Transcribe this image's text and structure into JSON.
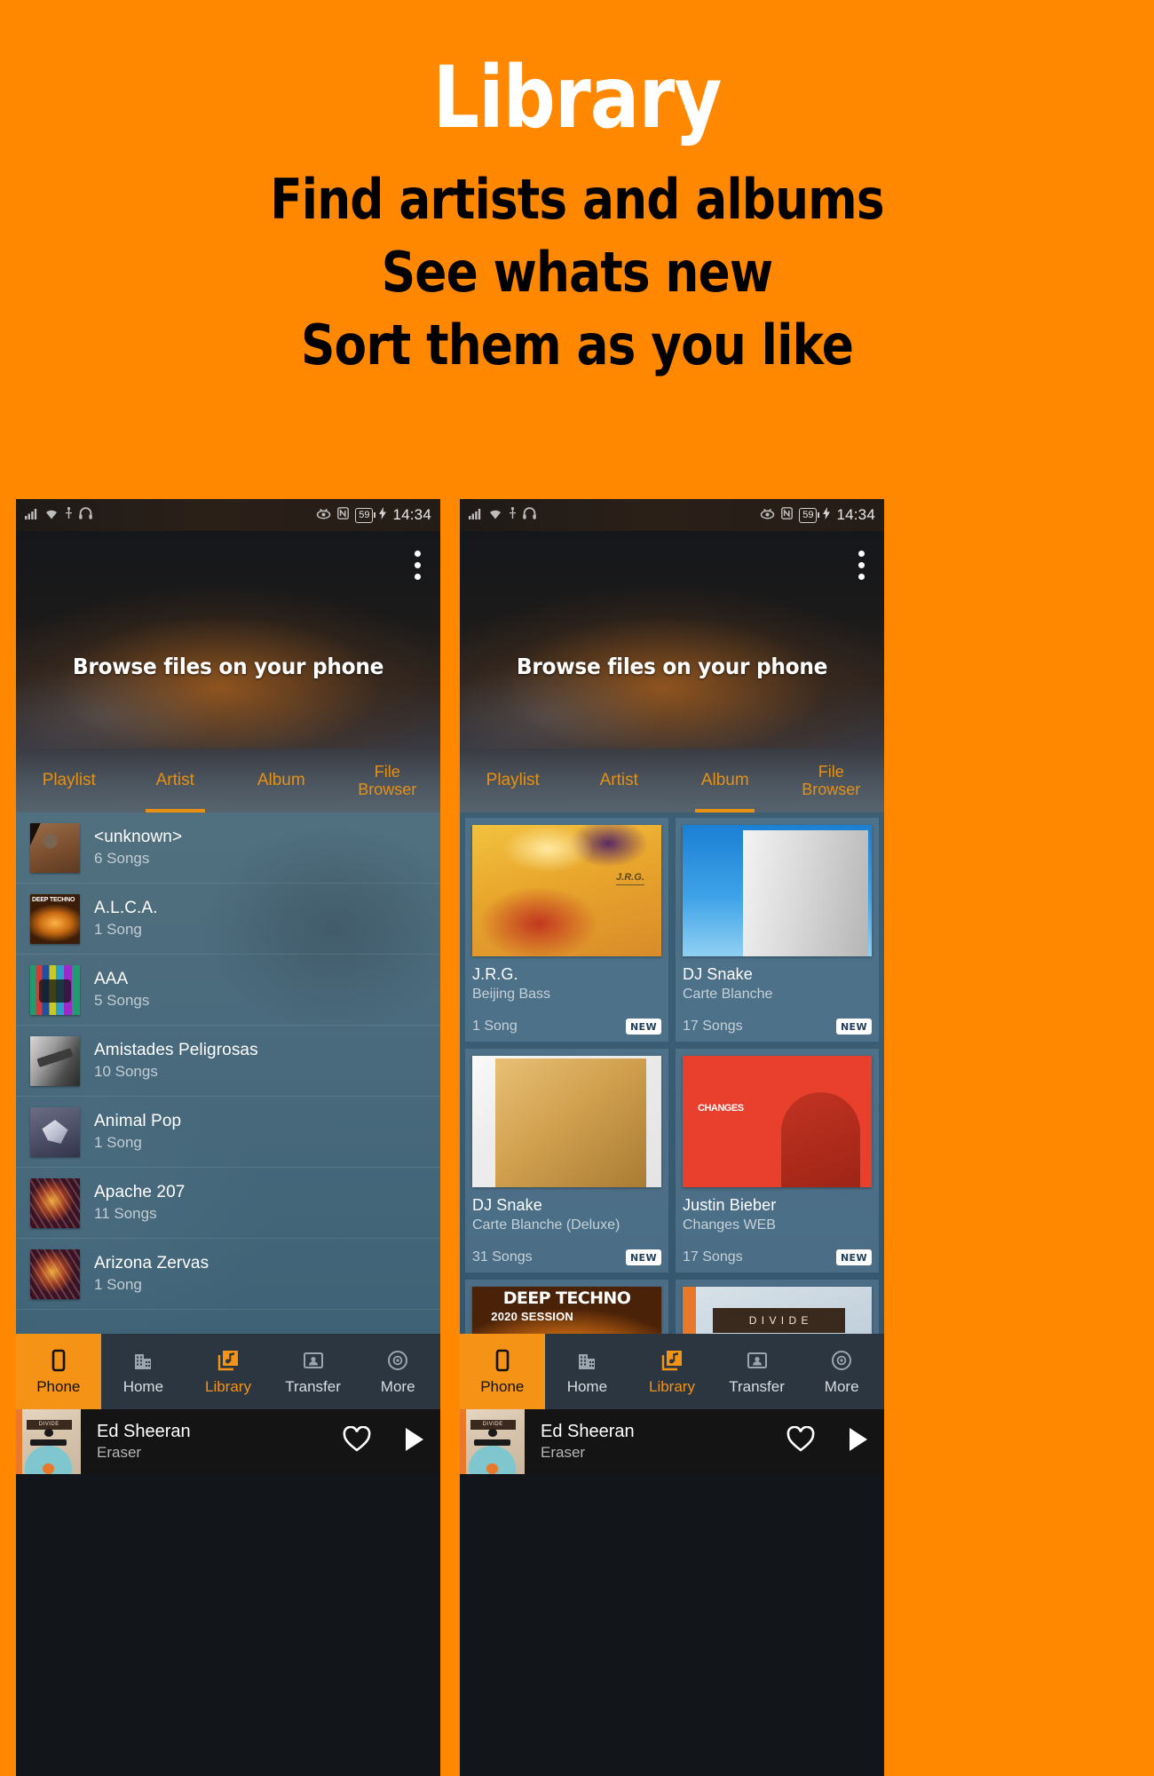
{
  "promo": {
    "title": "Library",
    "lines": [
      "Find artists and albums",
      "See whats new",
      "Sort them as you like"
    ],
    "background_color": "#FF8800",
    "title_color": "#FFFFFF",
    "line_color": "#000000"
  },
  "accent_color": "#F49316",
  "statusbar": {
    "icons_left": [
      "signal-icon",
      "wifi-icon",
      "usb-icon",
      "headphones-icon"
    ],
    "icons_right": [
      "eye-off-icon",
      "nfc-icon"
    ],
    "battery_level": "59",
    "charging_icon": "bolt-icon",
    "time": "14:34"
  },
  "header": {
    "title": "Browse files on your phone",
    "overflow_menu": "kebab-menu-icon"
  },
  "tabs": [
    {
      "label": "Playlist",
      "active": false
    },
    {
      "label": "Artist",
      "active": false
    },
    {
      "label": "Album",
      "active": false
    },
    {
      "label": "File\nBrowser",
      "label_line1": "File",
      "label_line2": "Browser",
      "active": false
    }
  ],
  "left_phone": {
    "active_tab": "Artist",
    "artists": [
      {
        "name": "<unknown>",
        "songs": "6 Songs",
        "art": "tb-unknown"
      },
      {
        "name": "A.L.C.A.",
        "songs": "1 Song",
        "art": "tb-techno"
      },
      {
        "name": "AAA",
        "songs": "5 Songs",
        "art": "tb-aaa"
      },
      {
        "name": "Amistades Peligrosas",
        "songs": "10 Songs",
        "art": "tb-amistades"
      },
      {
        "name": "Animal Pop",
        "songs": "1 Song",
        "art": "tb-animalpop"
      },
      {
        "name": "Apache 207",
        "songs": "11 Songs",
        "art": "tb-apache"
      },
      {
        "name": "Arizona Zervas",
        "songs": "1 Song",
        "art": "tb-apache"
      }
    ]
  },
  "right_phone": {
    "active_tab": "Album",
    "albums": [
      {
        "artist": "J.R.G.",
        "title": "Beijing Bass",
        "songs": "1 Song",
        "badge": "NEW",
        "art": "aa-jrg"
      },
      {
        "artist": "DJ Snake",
        "title": "Carte Blanche",
        "songs": "17 Songs",
        "badge": "NEW",
        "art": "aa-arc-blue"
      },
      {
        "artist": "DJ Snake",
        "title": "Carte Blanche (Deluxe)",
        "songs": "31 Songs",
        "badge": "NEW",
        "art": "aa-arc-gold"
      },
      {
        "artist": "Justin Bieber",
        "title": "Changes WEB",
        "songs": "17 Songs",
        "badge": "NEW",
        "art": "aa-changes"
      },
      {
        "artist": "",
        "title": "",
        "songs": "",
        "badge": "",
        "art": "aa-deeptechno"
      },
      {
        "artist": "",
        "title": "",
        "songs": "",
        "badge": "",
        "art": "aa-divide"
      }
    ]
  },
  "bottom_nav": [
    {
      "label": "Phone",
      "icon": "phone-icon",
      "active": true,
      "accent": false
    },
    {
      "label": "Home",
      "icon": "building-icon",
      "active": false,
      "accent": false
    },
    {
      "label": "Library",
      "icon": "music-library-icon",
      "active": false,
      "accent": true
    },
    {
      "label": "Transfer",
      "icon": "contact-card-icon",
      "active": false,
      "accent": false
    },
    {
      "label": "More",
      "icon": "disc-icon",
      "active": false,
      "accent": false
    }
  ],
  "now_playing": {
    "artist": "Ed Sheeran",
    "track": "Eraser",
    "favorite_icon": "heart-icon",
    "play_icon": "play-icon",
    "album_art_text": "DIVIDE"
  }
}
